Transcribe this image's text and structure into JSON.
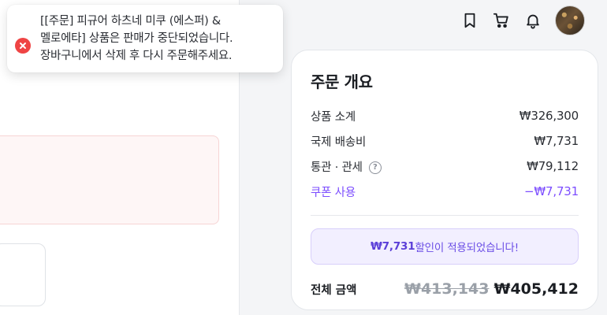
{
  "toast": {
    "message": "[[주문] 피규어 하츠네 미쿠 (에스퍼) &\n멜로에타] 상품은 판매가 중단되었습니다.\n장바구니에서 삭제 후 다시 주문해주세요.",
    "icon": "error-icon",
    "icon_color": "#ef4444"
  },
  "header": {
    "icons": [
      "bookmark-icon",
      "cart-icon",
      "bell-icon"
    ],
    "avatar": "user-avatar"
  },
  "summary": {
    "title": "주문 개요",
    "rows": [
      {
        "label": "상품 소계",
        "value": "₩326,300"
      },
      {
        "label": "국제 배송비",
        "value": "₩7,731"
      },
      {
        "label": "통관 · 관세",
        "value": "₩79,112",
        "help": "?"
      },
      {
        "label": "쿠폰 사용",
        "value": "−₩7,731"
      }
    ],
    "banner": {
      "amount": "₩7,731",
      "text": "할인이 적용되었습니다!"
    },
    "total": {
      "label": "전체 금액",
      "old": "₩413,143",
      "new": "₩405,412"
    },
    "accent_color": "#7c4dff"
  }
}
